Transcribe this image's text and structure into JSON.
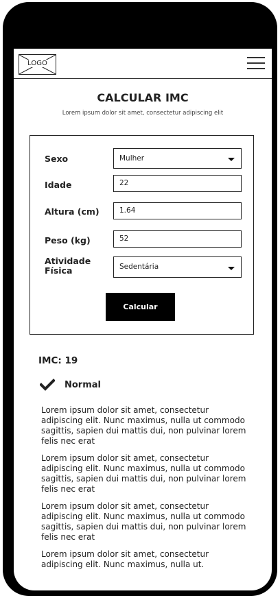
{
  "header": {
    "logo_label": "LOGO",
    "menu_icon": "hamburger-menu-icon"
  },
  "page": {
    "title": "CALCULAR IMC",
    "subtitle": "Lorem ipsum dolor sit amet, consectetur adipiscing elit"
  },
  "form": {
    "sex": {
      "label": "Sexo",
      "value": "Mulher"
    },
    "age": {
      "label": "Idade",
      "value": "22"
    },
    "height": {
      "label": "Altura (cm)",
      "value": "1.64"
    },
    "weight": {
      "label": "Peso (kg)",
      "value": "52"
    },
    "activity": {
      "label_line1": "Atividade",
      "label_line2": "Física",
      "value": "Sedentária"
    },
    "submit_label": "Calcular"
  },
  "result": {
    "imc_text": "IMC: 19",
    "status_icon": "checkmark-icon",
    "status_label": "Normal",
    "paragraphs": [
      "Lorem ipsum dolor sit amet, consectetur adipiscing elit. Nunc maximus, nulla ut commodo sagittis, sapien dui mattis dui, non pulvinar lorem felis nec erat",
      "Lorem ipsum dolor sit amet, consectetur adipiscing elit. Nunc maximus, nulla ut commodo sagittis, sapien dui mattis dui, non pulvinar lorem felis nec erat",
      "Lorem ipsum dolor sit amet, consectetur adipiscing elit. Nunc maximus, nulla ut commodo sagittis, sapien dui mattis dui, non pulvinar lorem felis nec erat",
      "Lorem ipsum dolor sit amet, consectetur adipiscing elit. Nunc maximus, nulla ut."
    ]
  }
}
